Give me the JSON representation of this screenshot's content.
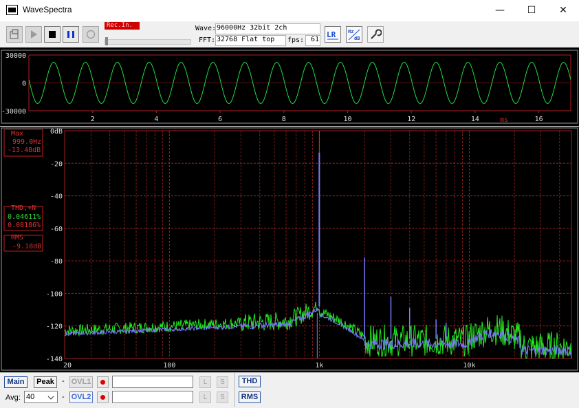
{
  "window": {
    "title": "WaveSpectra",
    "minimize_glyph": "—",
    "maximize_glyph": "☐",
    "close_glyph": "✕"
  },
  "toolbar": {
    "rec_in_label": "Rec.In.",
    "wave_label": "Wave:",
    "wave_value": "96000Hz 32bit 2ch",
    "fft_label": "FFT:",
    "fft_value": "32768 Flat top",
    "fps_label": "fps:",
    "fps_value": "61",
    "lr_icon_text": "LR",
    "hzdb_icon_text_top": "Hz",
    "hzdb_icon_text_bottom": "dB",
    "icons": [
      "open-icon",
      "play-icon",
      "stop-icon",
      "pause-icon",
      "record-icon",
      "lr-channel-icon",
      "hz-db-scale-icon",
      "settings-wrench-icon"
    ]
  },
  "wave_panel": {
    "y_ticks": [
      "30000",
      "0",
      "-30000"
    ],
    "x_ticks": [
      "2",
      "4",
      "6",
      "8",
      "10",
      "12",
      "14",
      "16"
    ],
    "x_unit": "ms",
    "trace_color": "#22dd44"
  },
  "spectrum_panel": {
    "y_ticks": [
      "0dB",
      "-20",
      "-40",
      "-60",
      "-80",
      "-100",
      "-120",
      "-140"
    ],
    "x_ticks": [
      "20",
      "100",
      "1k",
      "10k"
    ],
    "max_label": "Max",
    "max_freq": "999.0Hz",
    "max_level": "-13.48dB",
    "thd_label": "THD,+N",
    "thd_value": "0.04611%",
    "thdn_value": "0.08186%",
    "rms_label": "RMS",
    "rms_value": "-9.18dB",
    "left_color": "#22ee22",
    "right_color": "#7a7aff",
    "grid_color": "#a02020"
  },
  "chart_data": {
    "type": "line",
    "xlabel": "",
    "ylabel": "",
    "x_scale": "log",
    "xlim": [
      20,
      48000
    ],
    "ylim": [
      -140,
      0
    ],
    "peaks": [
      {
        "freq": 999.0,
        "level": -13.48
      },
      {
        "freq": 2000,
        "level": -78
      },
      {
        "freq": 3000,
        "level": -102
      },
      {
        "freq": 4000,
        "level": -109
      },
      {
        "freq": 6000,
        "level": -116
      },
      {
        "freq": 7000,
        "level": -118
      }
    ],
    "noise_floor": -124
  },
  "bottom": {
    "main_label": "Main",
    "peak_label": "Peak",
    "dash1": "-",
    "dash2": "-",
    "ovl1_label": "OVL1",
    "ovl2_label": "OVL2",
    "avg_label": "Avg:",
    "avg_value": "40",
    "l_label": "L",
    "s_label": "S",
    "thd_button": "THD",
    "rms_button": "RMS"
  }
}
